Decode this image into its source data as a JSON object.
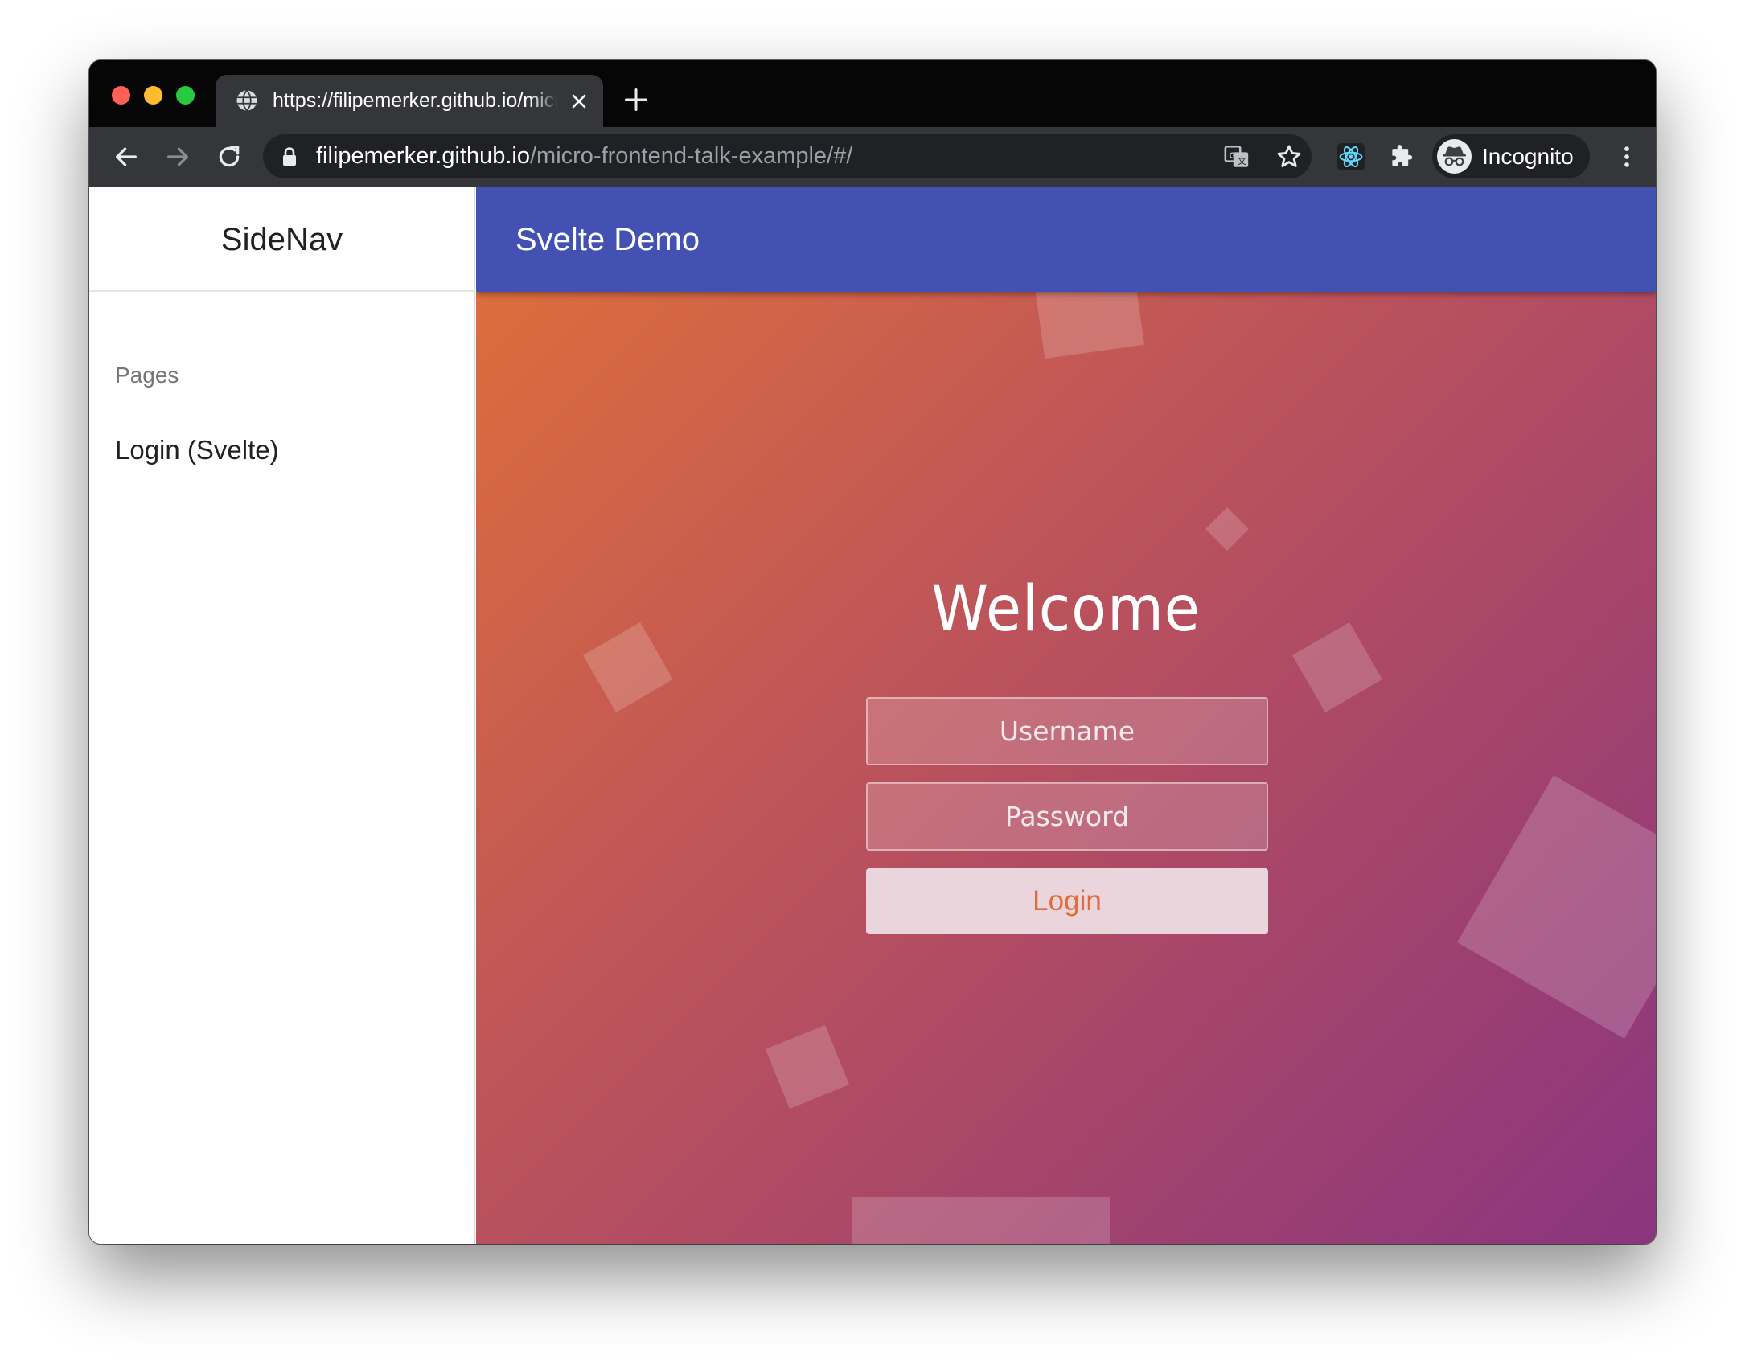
{
  "tab": {
    "title": "https://filipemerker.github.io/micro-frontend-talk-example/#/"
  },
  "omnibox": {
    "host": "filipemerker.github.io",
    "path": "/micro-frontend-talk-example/#/"
  },
  "profile": {
    "label": "Incognito"
  },
  "sidenav": {
    "title": "SideNav",
    "section_label": "Pages",
    "items": [
      {
        "label": "Login (Svelte)"
      }
    ]
  },
  "appbar": {
    "title": "Svelte Demo"
  },
  "login": {
    "heading": "Welcome",
    "username_placeholder": "Username",
    "password_placeholder": "Password",
    "button_label": "Login"
  },
  "colors": {
    "appbar": "#4352b2",
    "gradient_start": "#e07039",
    "gradient_end": "#8a357f",
    "login_button_text": "#e06b3b"
  },
  "icons": {
    "window_controls": [
      "close-dot",
      "minimize-dot",
      "zoom-dot"
    ],
    "tab": [
      "globe-icon",
      "close-icon"
    ],
    "toolbar": [
      "back-arrow-icon",
      "forward-arrow-icon",
      "reload-icon",
      "lock-icon",
      "translate-icon",
      "star-icon",
      "react-devtools-icon",
      "extensions-puzzle-icon",
      "incognito-icon",
      "kebab-menu-icon"
    ]
  }
}
